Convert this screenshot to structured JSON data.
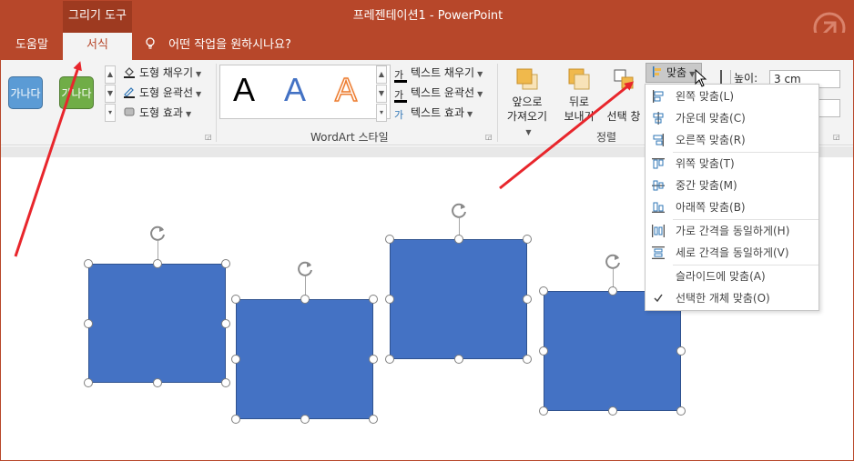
{
  "titlebar": {
    "context_tab": "그리기 도구",
    "title": "프레젠테이션1  -  PowerPoint"
  },
  "tabs": {
    "help": "도움말",
    "format": "서식",
    "tell_me": "어떤 작업을 원하시나요?"
  },
  "ribbon": {
    "shape_styles": {
      "swatch_text": "가나다",
      "fill": "도형 채우기",
      "outline": "도형 윤곽선",
      "effects": "도형 효과"
    },
    "wordart": {
      "letter": "A",
      "text_fill": "텍스트 채우기",
      "text_outline": "텍스트 윤곽선",
      "text_effects": "텍스트 효과",
      "group_label": "WordArt 스타일",
      "fill_glyph": "가",
      "outline_glyph": "가",
      "effects_glyph": "가"
    },
    "arrange": {
      "bring_forward_1": "앞으로",
      "bring_forward_2": "가져오기",
      "send_backward_1": "뒤로",
      "send_backward_2": "보내기",
      "selection_pane": "선택 창",
      "group_label": "정렬",
      "align": "맞춤"
    },
    "size": {
      "height_label": "높이:",
      "height_value": "3 cm"
    }
  },
  "align_menu": {
    "items": [
      {
        "label": "왼쪽 맞춤(L)",
        "icon": "align-left-icon"
      },
      {
        "label": "가운데 맞춤(C)",
        "icon": "align-center-icon"
      },
      {
        "label": "오른쪽 맞춤(R)",
        "icon": "align-right-icon"
      },
      {
        "label": "위쪽 맞춤(T)",
        "icon": "align-top-icon"
      },
      {
        "label": "중간 맞춤(M)",
        "icon": "align-middle-icon"
      },
      {
        "label": "아래쪽 맞춤(B)",
        "icon": "align-bottom-icon"
      },
      {
        "label": "가로 간격을 동일하게(H)",
        "icon": "distribute-horizontal-icon"
      },
      {
        "label": "세로 간격을 동일하게(V)",
        "icon": "distribute-vertical-icon"
      },
      {
        "label": "슬라이드에 맞춤(A)",
        "icon": ""
      },
      {
        "label": "선택한 개체 맞춤(O)",
        "icon": "checkmark-icon",
        "checked": true
      }
    ]
  },
  "colors": {
    "brand": "#b7472a",
    "shape_fill": "#4472c4",
    "annotation_arrow": "#e8262c"
  }
}
